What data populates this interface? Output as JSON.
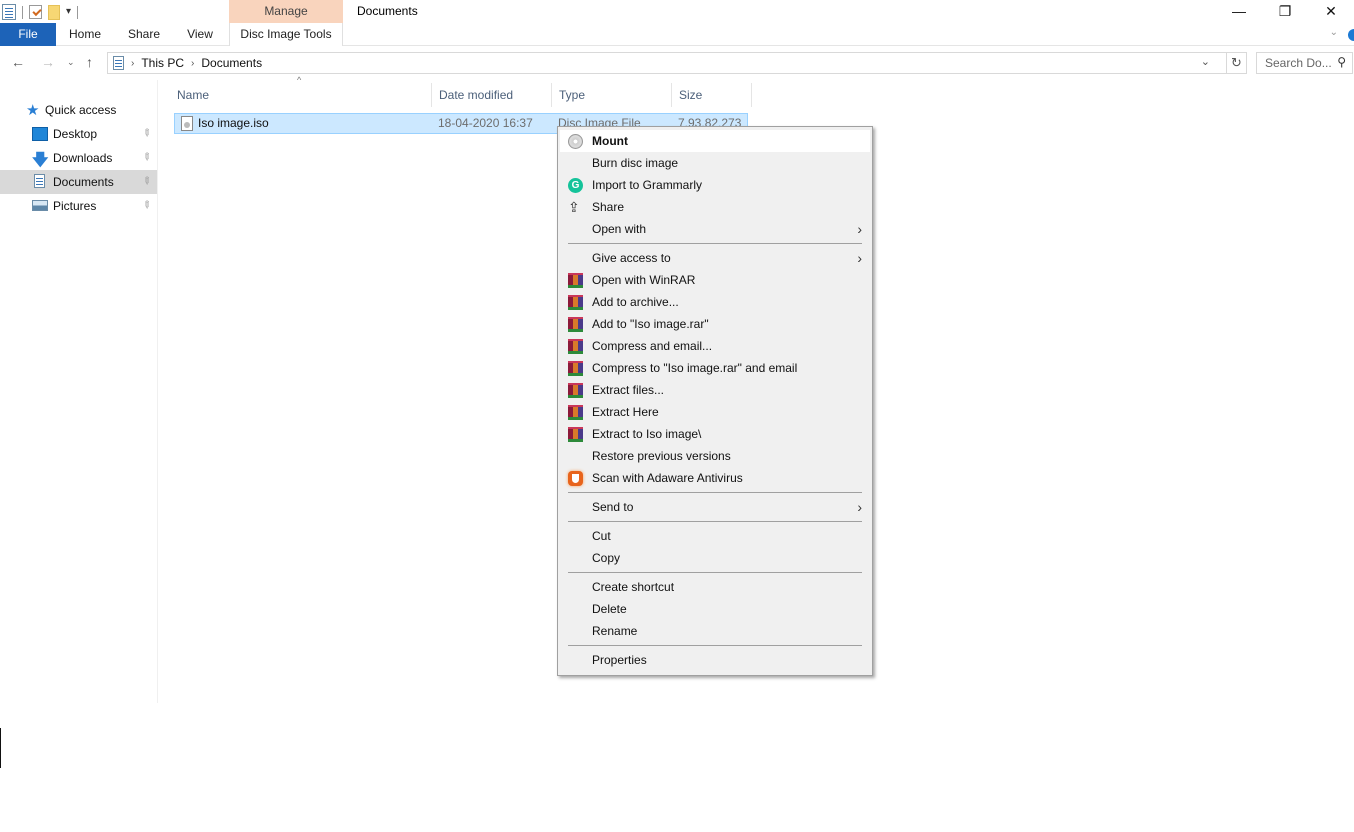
{
  "window": {
    "title": "Documents",
    "context_tab_header": "Manage",
    "controls": {
      "minimize": "—",
      "maximize": "❐",
      "close": "✕"
    }
  },
  "ribbon": {
    "tabs": [
      {
        "label": "File",
        "active": true
      },
      {
        "label": "Home"
      },
      {
        "label": "Share"
      },
      {
        "label": "View"
      },
      {
        "label": "Disc Image Tools"
      }
    ],
    "expand_icon": "⌄"
  },
  "navigation": {
    "back_icon": "←",
    "forward_icon": "→",
    "recent_icon": "⌄",
    "up_icon": "↑",
    "breadcrumb": [
      "This PC",
      "Documents"
    ],
    "breadcrumb_sep": "›",
    "address_dropdown_icon": "⌄",
    "refresh_icon": "↻",
    "search_placeholder": "Search Do...",
    "search_icon": "⚲"
  },
  "nav_pane": {
    "quick_access_label": "Quick access",
    "items": [
      {
        "label": "Desktop",
        "pinned": true
      },
      {
        "label": "Downloads",
        "pinned": true
      },
      {
        "label": "Documents",
        "pinned": true,
        "selected": true
      },
      {
        "label": "Pictures",
        "pinned": true
      }
    ],
    "pin_icon": "📌"
  },
  "file_list": {
    "columns": [
      "Name",
      "Date modified",
      "Type",
      "Size"
    ],
    "sort_indicator": "^",
    "files": [
      {
        "name": "Iso image.iso",
        "date_modified": "18-04-2020 16:37",
        "type": "Disc Image File",
        "size": "7,93,82,273",
        "selected": true
      }
    ]
  },
  "context_menu": {
    "groups": [
      [
        {
          "label": "Mount",
          "icon": "disc-icon",
          "default": true
        },
        {
          "label": "Burn disc image"
        },
        {
          "label": "Import to Grammarly",
          "icon": "grammarly-icon"
        },
        {
          "label": "Share",
          "icon": "share-icon"
        },
        {
          "label": "Open with",
          "submenu": true
        }
      ],
      [
        {
          "label": "Give access to",
          "submenu": true
        },
        {
          "label": "Open with WinRAR",
          "icon": "winrar-icon"
        },
        {
          "label": "Add to archive...",
          "icon": "winrar-icon"
        },
        {
          "label": "Add to \"Iso image.rar\"",
          "icon": "winrar-icon"
        },
        {
          "label": "Compress and email...",
          "icon": "winrar-icon"
        },
        {
          "label": "Compress to \"Iso image.rar\" and email",
          "icon": "winrar-icon"
        },
        {
          "label": "Extract files...",
          "icon": "winrar-icon"
        },
        {
          "label": "Extract Here",
          "icon": "winrar-icon"
        },
        {
          "label": "Extract to Iso image\\",
          "icon": "winrar-icon"
        },
        {
          "label": "Restore previous versions"
        },
        {
          "label": "Scan with Adaware Antivirus",
          "icon": "adaware-icon"
        }
      ],
      [
        {
          "label": "Send to",
          "submenu": true
        }
      ],
      [
        {
          "label": "Cut"
        },
        {
          "label": "Copy"
        }
      ],
      [
        {
          "label": "Create shortcut"
        },
        {
          "label": "Delete"
        },
        {
          "label": "Rename"
        }
      ],
      [
        {
          "label": "Properties"
        }
      ]
    ],
    "submenu_arrow": "›",
    "grammarly_glyph": "G",
    "share_glyph": "⇪"
  },
  "colors": {
    "file_tab_bg": "#1d63b8",
    "context_tab_bg": "#f9d4bd",
    "selection_bg": "#cce8ff",
    "selection_border": "#99d1ff",
    "menu_bg": "#f0f0f0",
    "nav_selected_bg": "#d9d9d9"
  }
}
